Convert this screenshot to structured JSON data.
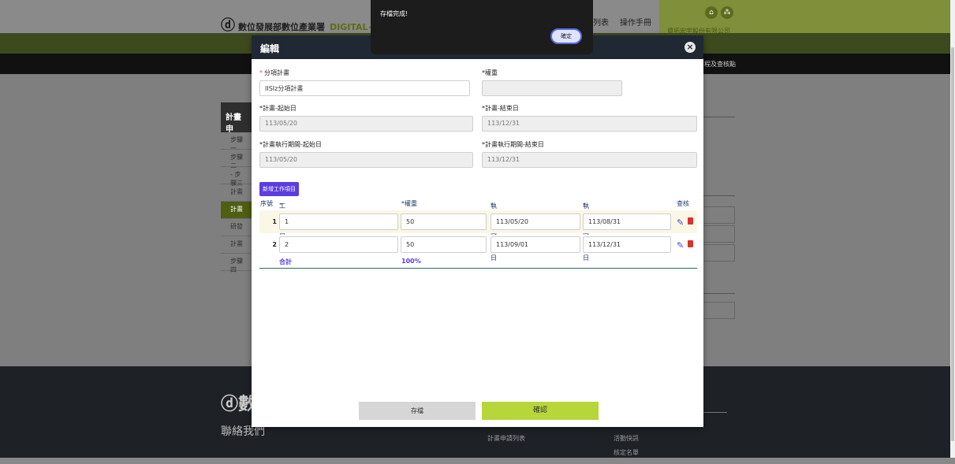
{
  "background": {
    "logo_text": "數位發展部數位產業署",
    "logo_sub": "DIGITAL+數",
    "nav_list": "列表",
    "nav_manual": "操作手冊",
    "company": "資拓宏宇股份有限公司",
    "breadcrumb": "程及查核點",
    "sidebar_head": "計畫申",
    "sidebar_items": [
      "步驟一",
      "步驟二",
      "- 步驟三",
      "計畫",
      "計畫",
      "研發",
      "計畫",
      "步驟四"
    ],
    "footer_logo": "數",
    "footer_contact": "聯絡我們",
    "footer_link_1": "計畫申請列表",
    "footer_link_2": "活動快訊",
    "footer_link_3": "核定名單"
  },
  "alert": {
    "message": "存檔完成!",
    "ok_label": "確定"
  },
  "modal": {
    "title": "編輯",
    "fields": {
      "sub_plan": {
        "label": "分項計畫",
        "value": "IISIz分項計畫"
      },
      "weight": {
        "label": "*權重",
        "value": ""
      },
      "plan_start": {
        "label": "*計畫-起始日",
        "value": "113/05/20"
      },
      "plan_end": {
        "label": "*計畫-結束日",
        "value": "113/12/31"
      },
      "exec_start": {
        "label": "*計畫執行期間-起始日",
        "value": "113/05/20"
      },
      "exec_end": {
        "label": "*計畫執行期間-結束日",
        "value": "113/12/31"
      }
    },
    "add_item_label": "新增工作項目",
    "table": {
      "headers": {
        "seq": "序號",
        "item": "工作項目",
        "weight": "*權重",
        "start": "執行期間-起始日",
        "end": "執行期間-結束日",
        "check": "查核"
      },
      "rows": [
        {
          "no": "1",
          "item": "1",
          "weight": "50",
          "start": "113/05/20",
          "end": "113/08/31"
        },
        {
          "no": "2",
          "item": "2",
          "weight": "50",
          "start": "113/09/01",
          "end": "113/12/31"
        }
      ],
      "total_label": "合計",
      "total_value": "100%"
    },
    "save_label": "存檔",
    "confirm_label": "確認"
  }
}
